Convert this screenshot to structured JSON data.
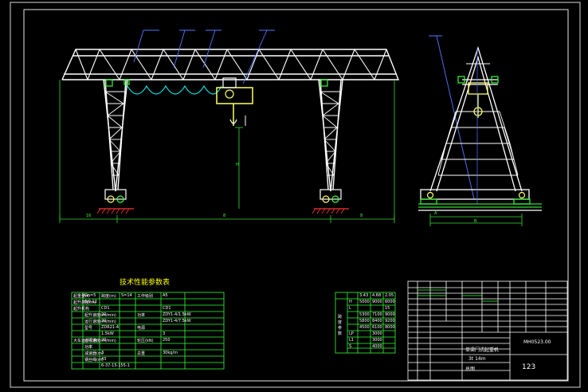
{
  "drawing": {
    "params_title": "技术性能参数表",
    "left_table": {
      "rows": [
        [
          "起重量(t)",
          "Gn=5",
          "跨度(m)",
          "S=14",
          "工作级别",
          "A5"
        ],
        [
          "起升高度(m)",
          "6.9,12",
          "",
          "",
          "",
          ""
        ],
        [
          "起升机构",
          "",
          "CD1",
          "",
          "",
          "CD1"
        ],
        [
          "",
          "起升速度(m/min)",
          "20",
          "",
          "功率",
          "ZDY1-4/1.5kW"
        ],
        [
          "",
          "运行速度(m/min)",
          "20",
          "",
          "",
          "ZDY1-4/7.5kW"
        ],
        [
          "",
          "型号",
          "ZDR21-4",
          "",
          "电源",
          ""
        ],
        [
          "",
          "",
          "1.5kW",
          "",
          "",
          "3"
        ],
        [
          "大车运行机构",
          "运行速度(m/min)",
          "20",
          "",
          "轮压(kN)",
          "250"
        ],
        [
          "",
          "功率",
          "",
          "",
          "",
          ""
        ],
        [
          "",
          "减速器(m)",
          "3",
          "",
          "总重",
          "30kg/m"
        ],
        [
          "",
          "钢丝绳(m)",
          "43",
          "",
          "",
          ""
        ],
        [
          "",
          "",
          "6-37-15-155-1",
          "",
          "",
          ""
        ]
      ]
    },
    "span_table": {
      "header": [
        "3.43",
        "4.68",
        "2.05"
      ],
      "rows": [
        [
          "H",
          "5000",
          "9000",
          "6000"
        ],
        [
          "L",
          "",
          "",
          "15"
        ],
        [
          "",
          "5300",
          "7100",
          "9000"
        ],
        [
          "",
          "5800",
          "8400",
          "9200"
        ],
        [
          "",
          "4500",
          "6100",
          "8000"
        ],
        [
          "LP",
          "",
          "3000",
          ""
        ],
        [
          "L1",
          "",
          "3000",
          ""
        ],
        [
          "S",
          "",
          "4000",
          ""
        ]
      ],
      "side_label": "跨度 参数"
    },
    "title_block": {
      "drawing_no": "MH0523.00",
      "name": "单梁门式起重机",
      "spec": "3t    14m",
      "sheet": "123",
      "assembly": "总图"
    },
    "dimensions": {
      "span_left": "16",
      "span_mid": "8",
      "span_right": "8",
      "height": "H",
      "side_a": "A",
      "side_b": "B"
    }
  }
}
